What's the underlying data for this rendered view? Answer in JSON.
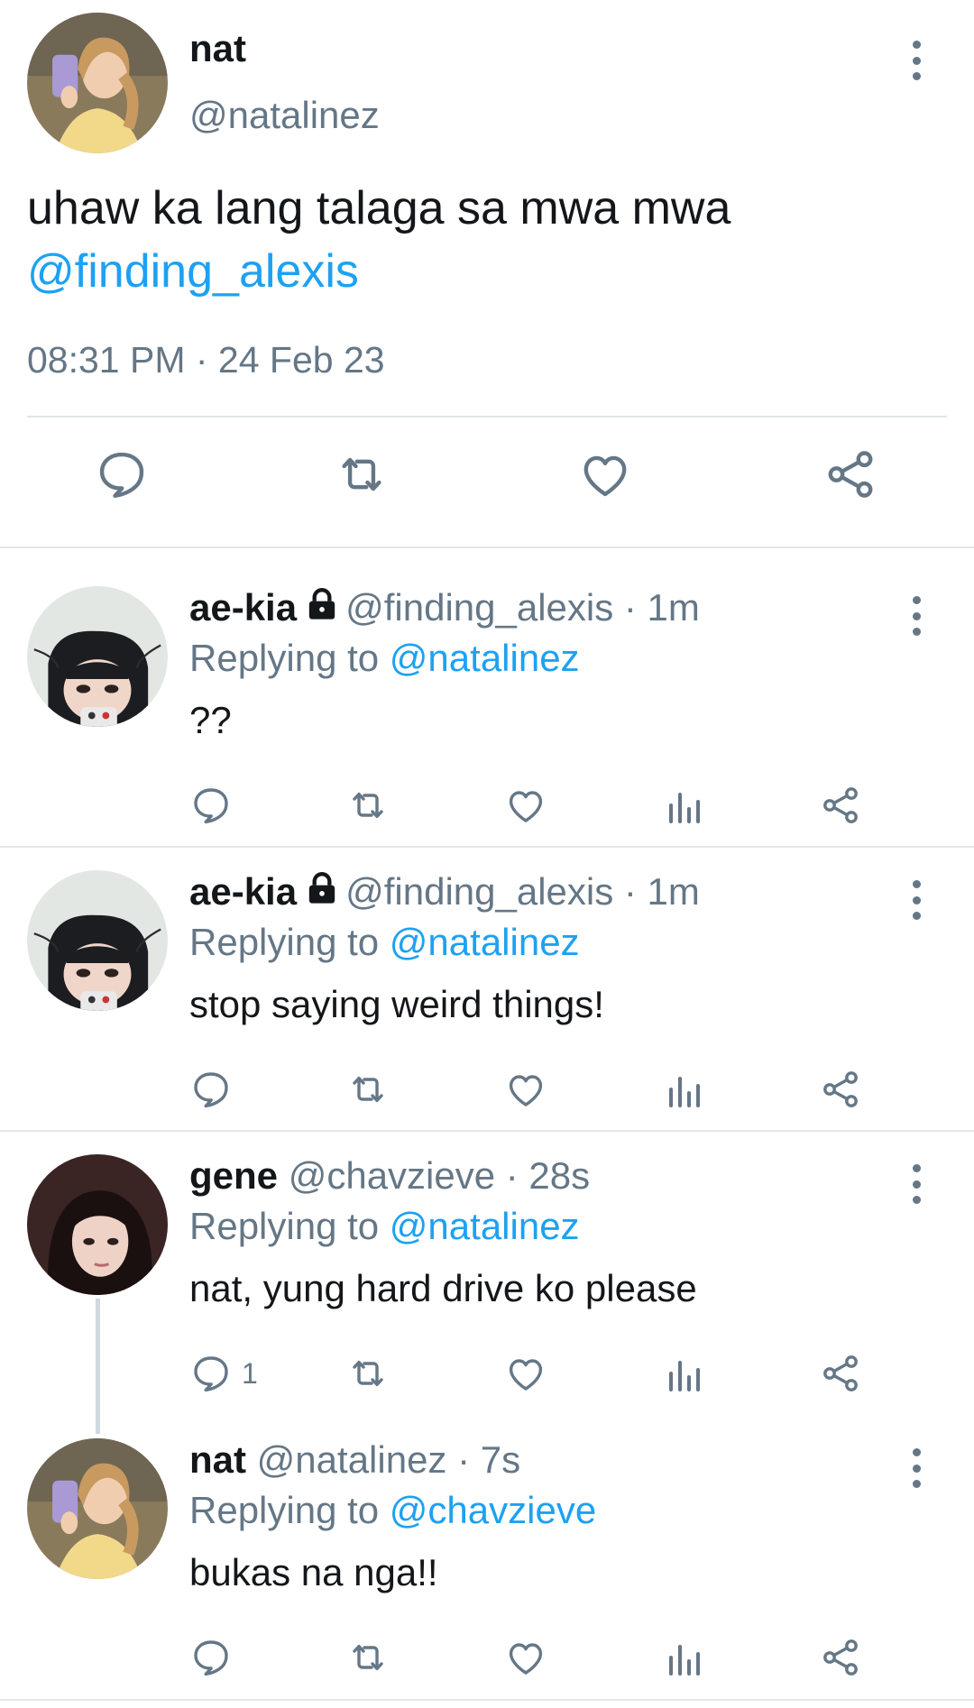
{
  "colors": {
    "link": "#1da1f2",
    "muted": "#657786",
    "divider": "#e1e8ed"
  },
  "main_tweet": {
    "name": "nat",
    "handle": "@natalinez",
    "text": "uhaw ka lang talaga sa mwa mwa",
    "mention": "@finding_alexis",
    "timestamp": "08:31 PM · 24 Feb 23",
    "actions": [
      "reply-icon",
      "retweet-icon",
      "like-icon",
      "share-icon"
    ]
  },
  "replies": [
    {
      "name": "ae-kia",
      "locked": true,
      "handle": "@finding_alexis",
      "time": "· 1m",
      "replying_prefix": "Replying to",
      "replying_to": "@natalinez",
      "text": "??",
      "reply_count": ""
    },
    {
      "name": "ae-kia",
      "locked": true,
      "handle": "@finding_alexis",
      "time": "· 1m",
      "replying_prefix": "Replying to",
      "replying_to": "@natalinez",
      "text": "stop saying weird things!",
      "reply_count": ""
    },
    {
      "name": "gene",
      "locked": false,
      "handle": "@chavzieve",
      "time": "· 28s",
      "replying_prefix": "Replying to",
      "replying_to": "@natalinez",
      "text": "nat, yung hard drive ko please",
      "reply_count": "1"
    },
    {
      "name": "nat",
      "locked": false,
      "handle": "@natalinez",
      "time": "· 7s",
      "replying_prefix": "Replying to",
      "replying_to": "@chavzieve",
      "text": "bukas na nga!!",
      "reply_count": ""
    }
  ]
}
